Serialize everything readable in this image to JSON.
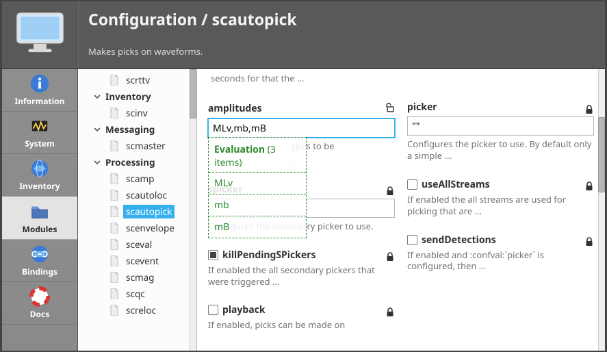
{
  "header": {
    "breadcrumb": "Configuration / scautopick",
    "subtitle": "Makes picks on waveforms."
  },
  "leftnav": [
    {
      "key": "information",
      "label": "Information"
    },
    {
      "key": "system",
      "label": "System"
    },
    {
      "key": "inventory",
      "label": "Inventory"
    },
    {
      "key": "modules",
      "label": "Modules"
    },
    {
      "key": "bindings",
      "label": "Bindings"
    },
    {
      "key": "docs",
      "label": "Docs"
    }
  ],
  "leftnav_active": "modules",
  "tree": {
    "top_orphan": "scrttv",
    "groups": [
      {
        "name": "Inventory",
        "children": [
          "scinv"
        ]
      },
      {
        "name": "Messaging",
        "children": [
          "scmaster"
        ]
      },
      {
        "name": "Processing",
        "children": [
          "scamp",
          "scautoloc",
          "scautopick",
          "scenvelope",
          "sceval",
          "scevent",
          "scmag",
          "scqc",
          "screloc"
        ]
      }
    ],
    "selected": "scautopick"
  },
  "content_top_truncated": "seconds for that the ...",
  "params_left": [
    {
      "key": "amplitudes",
      "label": "amplitudes",
      "lock": "open",
      "value": "MLv,mb,mB",
      "focused": true,
      "desc_fragment_before": "                                    ypes to be",
      "desc_fragment_after": "                                    ..."
    },
    {
      "key": "spicker",
      "label": "spicker",
      "lock": "closed",
      "value": "",
      "desc": "Configures the secondary picker to use."
    },
    {
      "key": "killPendingSPickers",
      "label": "killPendingSPickers",
      "lock": "closed",
      "checkbox": "mixed",
      "desc": "If enabled the all secondary pickers that were triggered ..."
    },
    {
      "key": "playback",
      "label": "playback",
      "lock": "closed",
      "checkbox": "unchecked",
      "desc": "If enabled, picks can be made on"
    }
  ],
  "params_right": [
    {
      "key": "picker",
      "label": "picker",
      "lock": "closed",
      "value": "\"\"",
      "desc": "Configures the picker to use. By default only a simple ..."
    },
    {
      "key": "useAllStreams",
      "label": "useAllStreams",
      "lock": "closed",
      "checkbox": "unchecked",
      "desc": "If enabled the all streams are used for picking that are ..."
    },
    {
      "key": "sendDetections",
      "label": "sendDetections",
      "lock": "closed",
      "checkbox": "unchecked",
      "desc": "If enabled and :confval:`picker` is configured, then ..."
    }
  ],
  "evaluation": {
    "title": "Evaluation",
    "count_label": "(3 items)",
    "items": [
      "MLv",
      "mb",
      "mB"
    ]
  }
}
